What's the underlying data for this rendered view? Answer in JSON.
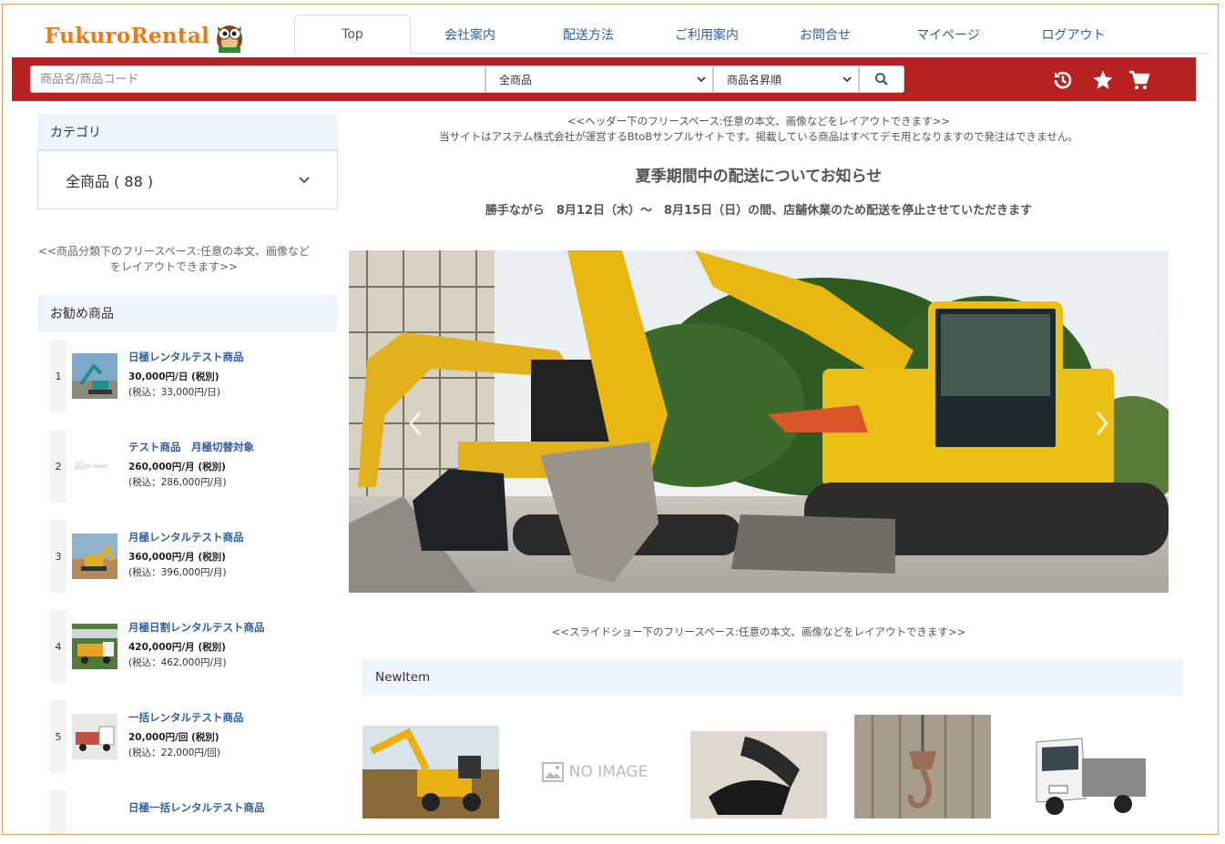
{
  "header": {
    "logo_text": "FukuroRental",
    "nav": [
      {
        "label": "Top",
        "active": true
      },
      {
        "label": "会社案内"
      },
      {
        "label": "配送方法"
      },
      {
        "label": "ご利用案内"
      },
      {
        "label": "お問合せ"
      },
      {
        "label": "マイページ"
      },
      {
        "label": "ログアウト"
      }
    ]
  },
  "search": {
    "placeholder": "商品名/商品コード",
    "category_selected": "全商品",
    "sort_selected": "商品名昇順",
    "button_icon": "search-icon",
    "header_icons": [
      "history-icon",
      "star-icon",
      "cart-icon"
    ]
  },
  "colors": {
    "brand_red": "#b72121",
    "brand_orange": "#f07a12",
    "link_blue": "#2e5fa7",
    "panel_bg": "#eef5fc"
  },
  "sidebar": {
    "category_title": "カテゴリ",
    "category_all": "全商品 ( 88 )",
    "free_space": "<<商品分類下のフリースペース:任意の本文、画像など\nをレイアウトできます>>",
    "recommend_title": "お勧め商品",
    "recommended": [
      {
        "rank": "1",
        "name": "日極レンタルテスト商品",
        "price": "30,000円/日 (税別)",
        "tax": "(税込：33,000円/日)"
      },
      {
        "rank": "2",
        "name": "テスト商品　月極切替対象",
        "price": "260,000円/月 (税別)",
        "tax": "(税込：286,000円/月)"
      },
      {
        "rank": "3",
        "name": "月極レンタルテスト商品",
        "price": "360,000円/月 (税別)",
        "tax": "(税込：396,000円/月)"
      },
      {
        "rank": "4",
        "name": "月極日割レンタルテスト商品",
        "price": "420,000円/月 (税別)",
        "tax": "(税込：462,000円/月)"
      },
      {
        "rank": "5",
        "name": "一括レンタルテスト商品",
        "price": "20,000円/回 (税別)",
        "tax": "(税込：22,000円/回)"
      },
      {
        "rank": "",
        "name": "日極一括レンタルテスト商品",
        "price": "",
        "tax": ""
      }
    ]
  },
  "main": {
    "free_top_1": "<<ヘッダー下のフリースペース:任意の本文、画像などをレイアウトできます>>",
    "free_top_2": "当サイトはアステム株式会社が運営するBtoBサンプルサイトです。掲載している商品はすべてデモ用となりますので発注はできません。",
    "notice_title": "夏季期間中の配送についてお知らせ",
    "notice_body": "勝手ながら　8月12日（木）～　8月15日（日）の間、店舗休業のため配送を停止させていただきます",
    "free_slide": "<<スライドショー下のフリースペース:任意の本文、画像などをレイアウトできます>>",
    "newitem_title": "NewItem",
    "no_image_text": "NO IMAGE"
  }
}
